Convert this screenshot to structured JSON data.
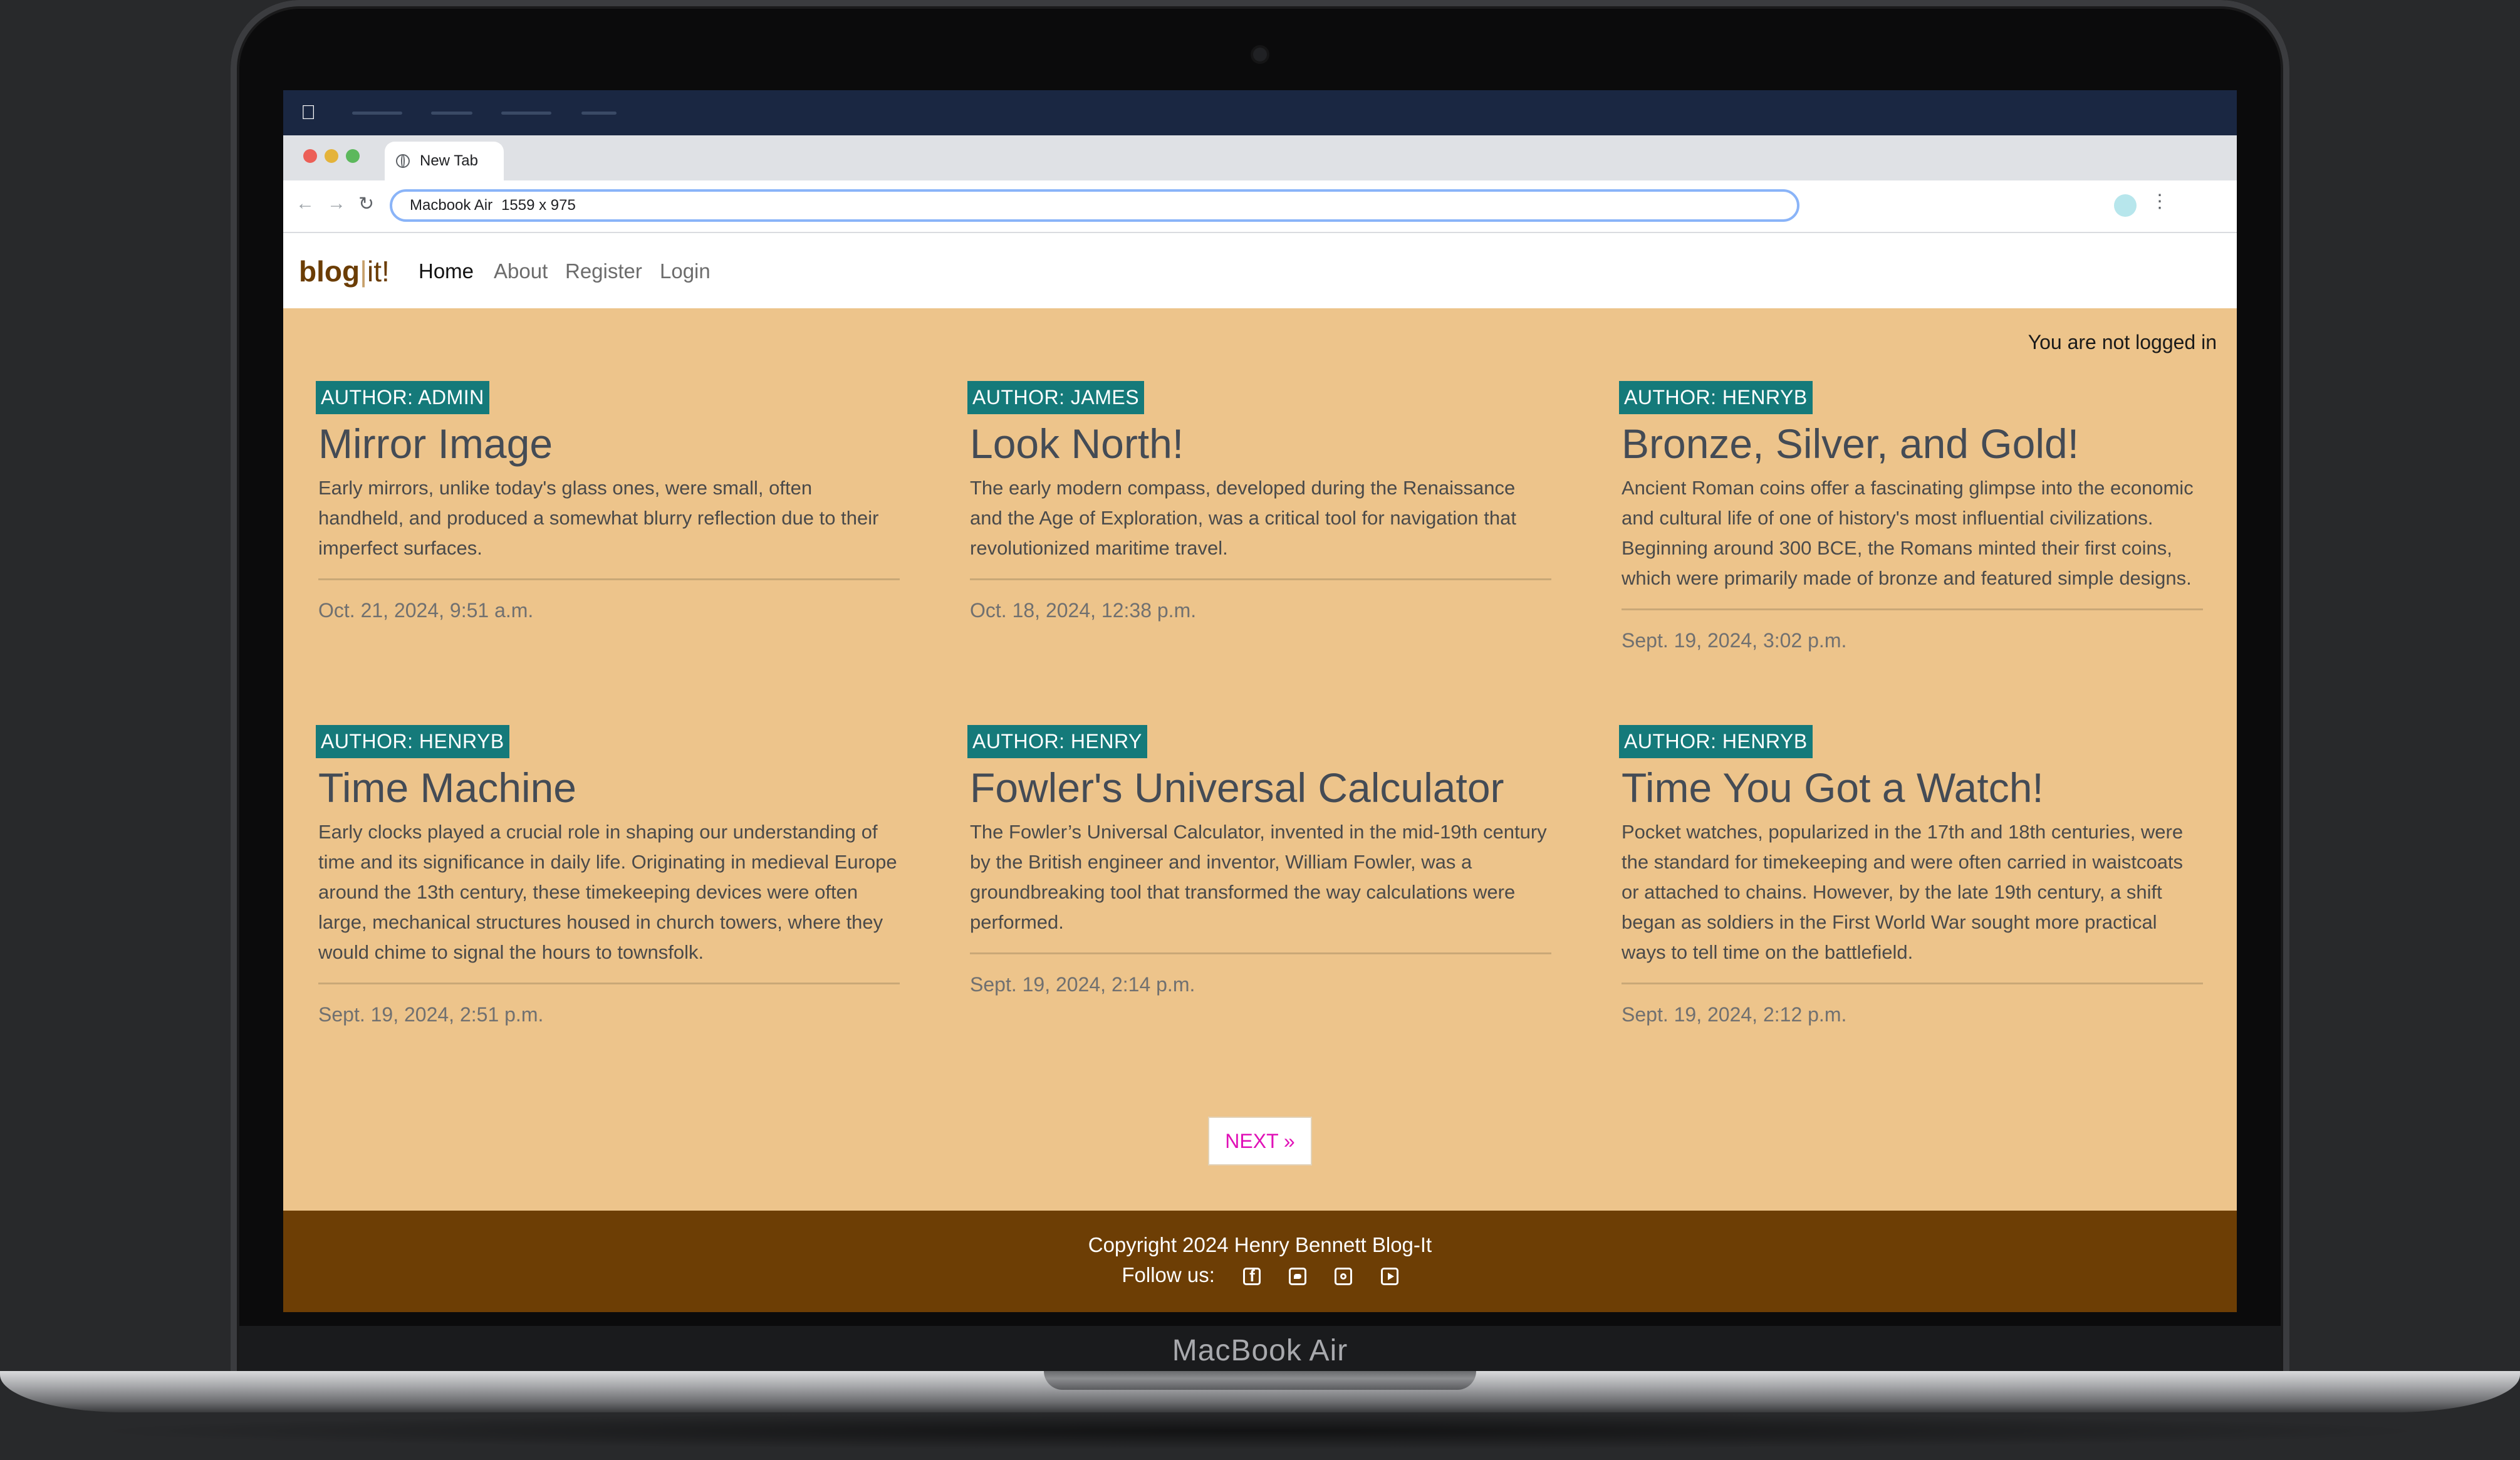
{
  "device": {
    "brand_label": "MacBook Air"
  },
  "browser": {
    "tab_title": "New Tab",
    "address_label": "Macbook Air",
    "address_size": "1559 x 975"
  },
  "site": {
    "logo": {
      "part1": "blog",
      "separator": "|",
      "part2": "it!"
    },
    "nav": [
      {
        "label": "Home",
        "active": true
      },
      {
        "label": "About",
        "active": false
      },
      {
        "label": "Register",
        "active": false
      },
      {
        "label": "Login",
        "active": false
      }
    ],
    "login_status": "You are not logged in",
    "posts": [
      {
        "author": "AUTHOR: ADMIN",
        "title": "Mirror Image",
        "excerpt": "Early mirrors, unlike today's glass ones, were small, often handheld, and produced a somewhat blurry reflection due to their imperfect surfaces.",
        "date": "Oct. 21, 2024, 9:51 a.m."
      },
      {
        "author": "AUTHOR: JAMES",
        "title": "Look North!",
        "excerpt": "The early modern compass, developed during the Renaissance and the Age of Exploration, was a critical tool for navigation that revolutionized maritime travel.",
        "date": "Oct. 18, 2024, 12:38 p.m."
      },
      {
        "author": "AUTHOR: HENRYB",
        "title": "Bronze, Silver, and Gold!",
        "excerpt": "Ancient Roman coins offer a fascinating glimpse into the economic and cultural life of one of history's most influential civilizations. Beginning around 300 BCE, the Romans minted their first coins, which were primarily made of bronze and featured simple designs.",
        "date": "Sept. 19, 2024, 3:02 p.m."
      },
      {
        "author": "AUTHOR: HENRYB",
        "title": "Time Machine",
        "excerpt": "Early clocks played a crucial role in shaping our understanding of time and its significance in daily life. Originating in medieval Europe around the 13th century, these timekeeping devices were often large, mechanical structures housed in church towers, where they would chime to signal the hours to townsfolk.",
        "date": "Sept. 19, 2024, 2:51 p.m."
      },
      {
        "author": "AUTHOR: HENRY",
        "title": "Fowler's Universal Calculator",
        "excerpt": "The Fowler’s Universal Calculator, invented in the mid-19th century by the British engineer and inventor, William Fowler, was a groundbreaking tool that transformed the way calculations were performed.",
        "date": "Sept. 19, 2024, 2:14 p.m."
      },
      {
        "author": "AUTHOR: HENRYB",
        "title": "Time You Got a Watch!",
        "excerpt": "Pocket watches, popularized in the 17th and 18th centuries, were the standard for timekeeping and were often carried in waistcoats or attached to chains. However, by the late 19th century, a shift began as soldiers in the First World War sought more practical ways to tell time on the battlefield.",
        "date": "Sept. 19, 2024, 2:12 p.m."
      }
    ],
    "pager": {
      "next_label": "NEXT »"
    },
    "footer": {
      "copyright": "Copyright 2024 Henry Bennett Blog-It",
      "follow_label": "Follow us:",
      "social_icons": [
        "facebook-icon",
        "twitter-icon",
        "instagram-icon",
        "youtube-icon"
      ]
    }
  },
  "colors": {
    "page_bg": "#edc48b",
    "badge": "#157a7a",
    "footer": "#6d3e05",
    "pager_text": "#e011b7",
    "menubar": "#1a2742"
  }
}
